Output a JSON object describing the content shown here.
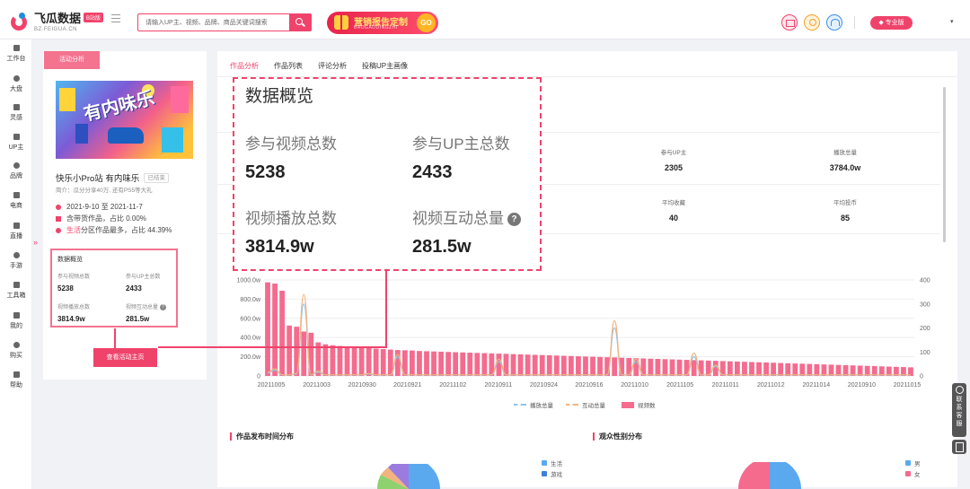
{
  "brand": {
    "name": "飞瓜数据",
    "badge": "B站版",
    "url": "BZ.FEIGUA.CN"
  },
  "search": {
    "placeholder": "请输入UP主、视频、品牌、商品关键词搜索"
  },
  "promo": {
    "title": "营销报告定制",
    "subtitle": "BAOGAODINGZHI",
    "go": "GO"
  },
  "header": {
    "vip_label": "专业版",
    "caret": "▾"
  },
  "rail": [
    {
      "label": "工作台",
      "icon": "home-icon"
    },
    {
      "label": "大盘",
      "icon": "market-icon"
    },
    {
      "label": "灵感",
      "icon": "bulb-icon"
    },
    {
      "label": "UP主",
      "icon": "search-user-icon"
    },
    {
      "label": "品牌",
      "icon": "brand-icon"
    },
    {
      "label": "电商",
      "icon": "cart-icon"
    },
    {
      "label": "直播",
      "icon": "live-icon"
    },
    {
      "label": "手游",
      "icon": "gamepad-icon"
    },
    {
      "label": "工具箱",
      "icon": "toolbox-icon"
    },
    {
      "label": "我的",
      "icon": "user-icon"
    },
    {
      "label": "购买",
      "icon": "purchase-icon"
    },
    {
      "label": "帮助",
      "icon": "help-icon"
    }
  ],
  "rail_toggle": "»",
  "activity": {
    "tab": "活动分析",
    "cover_text": "有内味乐",
    "name": "快乐小Pro站 有内味乐",
    "status": "已结束",
    "desc": "简介：瓜分分享40万, 还有PS5等大礼",
    "date_range": "2021-9-10 至 2021-11-7",
    "goods": "含带货作品，占比 0.00%",
    "category_highlight": "生活",
    "category_rest": " 分区作品最多，占比 44.39%",
    "button": "查看活动主页"
  },
  "overview": {
    "title": "数据概览",
    "items": [
      {
        "label": "参与视频总数",
        "value": "5238"
      },
      {
        "label": "参与UP主总数",
        "value": "2433"
      },
      {
        "label": "视频播放总数",
        "value": "3814.9w"
      },
      {
        "label": "视频互动总量",
        "value": "281.5w"
      }
    ],
    "help": "?"
  },
  "tabs": [
    "作品分析",
    "作品列表",
    "评论分析",
    "投稿UP主画像"
  ],
  "stats": [
    {
      "label": "参与UP主",
      "value": "2305"
    },
    {
      "label": "播放总量",
      "value": "3784.0w"
    },
    {
      "label": "平均收藏",
      "value": "40"
    },
    {
      "label": "平均投币",
      "value": "85"
    }
  ],
  "chart_data": {
    "type": "bar",
    "x_ticks": [
      "20211005",
      "20211003",
      "20210930",
      "20210921",
      "20211102",
      "20210911",
      "20210924",
      "20210916",
      "20211010",
      "20211105",
      "20211011",
      "20211012",
      "20211014",
      "20210910",
      "20211015"
    ],
    "left_axis": [
      "0",
      "200.0w",
      "400.0w",
      "600.0w",
      "800.0w",
      "1000.0w"
    ],
    "right_axis": [
      "0",
      "100",
      "200",
      "300",
      "400"
    ],
    "ylim_left": [
      0,
      1000
    ],
    "ylim_right": [
      0,
      400
    ],
    "series": [
      {
        "name": "播放总量",
        "color": "#8fc3e8",
        "type": "line",
        "axis": "left",
        "values": [
          30,
          60,
          10,
          10,
          20,
          750,
          10,
          40,
          10,
          10,
          10,
          10,
          10,
          10,
          20,
          10,
          10,
          10,
          200,
          10,
          10,
          10,
          10,
          10,
          10,
          10,
          10,
          10,
          10,
          10,
          10,
          10,
          150,
          10,
          10,
          10,
          10,
          10,
          10,
          10,
          10,
          10,
          10,
          10,
          10,
          10,
          10,
          10,
          500,
          10,
          10,
          150,
          10,
          10,
          10,
          10,
          10,
          10,
          10,
          200,
          10,
          10,
          100,
          10,
          10,
          10,
          10,
          10,
          10,
          10,
          10,
          10,
          10,
          10,
          10,
          10,
          10,
          10,
          10,
          10,
          10,
          10,
          10,
          10,
          10,
          10,
          10,
          10,
          10,
          10
        ]
      },
      {
        "name": "互动总量",
        "color": "#f3b37e",
        "type": "line",
        "axis": "right",
        "values": [
          15,
          30,
          5,
          5,
          10,
          340,
          5,
          20,
          5,
          5,
          5,
          5,
          5,
          5,
          10,
          5,
          5,
          5,
          90,
          5,
          5,
          5,
          5,
          5,
          5,
          5,
          5,
          5,
          5,
          5,
          5,
          5,
          70,
          5,
          5,
          5,
          5,
          5,
          5,
          5,
          5,
          5,
          5,
          5,
          5,
          5,
          5,
          5,
          230,
          5,
          5,
          70,
          5,
          5,
          5,
          5,
          5,
          5,
          5,
          95,
          5,
          5,
          45,
          5,
          5,
          5,
          5,
          5,
          5,
          5,
          5,
          5,
          5,
          5,
          5,
          5,
          5,
          5,
          5,
          5,
          5,
          5,
          5,
          5,
          5,
          5,
          5,
          5,
          5,
          5
        ]
      },
      {
        "name": "视频数",
        "color": "#f46b8e",
        "type": "bar",
        "axis": "right",
        "values": [
          390,
          385,
          355,
          210,
          205,
          185,
          180,
          140,
          132,
          128,
          125,
          123,
          120,
          118,
          116,
          114,
          112,
          110,
          108,
          107,
          106,
          104,
          103,
          102,
          101,
          100,
          99,
          98,
          97,
          96,
          95,
          94,
          93,
          92,
          91,
          90,
          89,
          88,
          87,
          86,
          85,
          84,
          83,
          82,
          81,
          80,
          79,
          78,
          77,
          76,
          75,
          74,
          73,
          72,
          71,
          70,
          69,
          68,
          67,
          66,
          65,
          64,
          63,
          62,
          61,
          60,
          59,
          58,
          57,
          56,
          55,
          54,
          53,
          52,
          51,
          50,
          49,
          48,
          47,
          46,
          45,
          44,
          43,
          42,
          41,
          40,
          39,
          38,
          37,
          36
        ]
      }
    ]
  },
  "sections": {
    "time_title": "作品发布时间分布",
    "gender_title": "观众性别分布"
  },
  "pie_legends": {
    "time": [
      {
        "label": "生活",
        "color": "#5aa9ef"
      },
      {
        "label": "游戏",
        "color": "#3f7fd8"
      }
    ],
    "gender": [
      {
        "label": "男",
        "color": "#5aa9ef"
      },
      {
        "label": "女",
        "color": "#f46b8e"
      }
    ]
  },
  "float": {
    "cs": "联系客服"
  }
}
